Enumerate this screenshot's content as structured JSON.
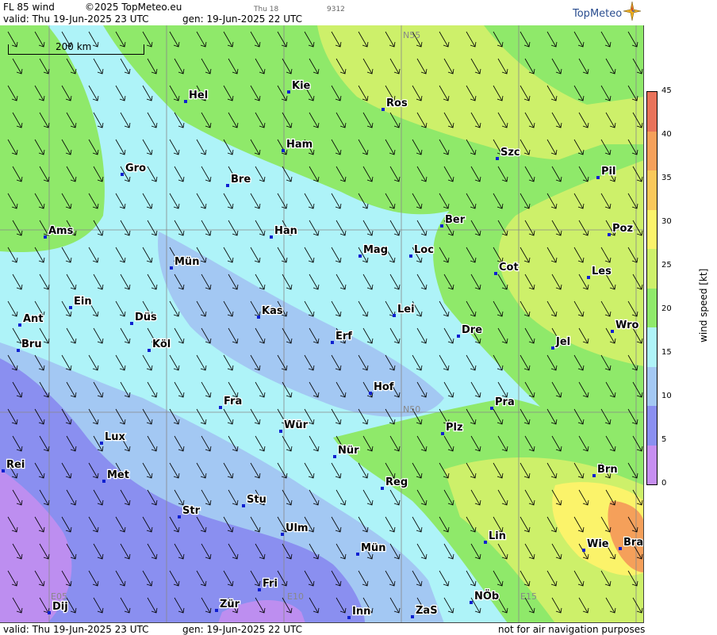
{
  "header": {
    "product": "FL 85 wind",
    "copyright": "©2025 TopMeteo.eu",
    "valid": "valid:  Thu  19-Jun-2025  23 UTC",
    "gen": "gen: 19-Jun-2025 22 UTC",
    "day": "Thu 18",
    "code": "9312",
    "logo": "TopMeteo"
  },
  "footer": {
    "valid": "valid:  Thu  19-Jun-2025  23 UTC",
    "gen": "gen: 19-Jun-2025 22 UTC",
    "disclaimer": "not for air navigation purposes"
  },
  "scale_bar": {
    "label": "200 km"
  },
  "grid_labels": [
    {
      "text": "N55"
    },
    {
      "text": "N50"
    },
    {
      "text": "E05"
    },
    {
      "text": "E10"
    },
    {
      "text": "E15"
    }
  ],
  "colorbar": {
    "title": "wind speed [kt]",
    "ticks": [
      "45",
      "40",
      "35",
      "30",
      "25",
      "20",
      "15",
      "10",
      "5",
      "0"
    ],
    "colors": [
      "#e8725a",
      "#f5a05a",
      "#f9c85a",
      "#fbf36a",
      "#cdf06a",
      "#8fe96a",
      "#aef3f8",
      "#a3c8f3",
      "#8a8ff0",
      "#c68ef0"
    ]
  },
  "cities": [
    {
      "name": "Hel"
    },
    {
      "name": "Kie"
    },
    {
      "name": "Ros"
    },
    {
      "name": "Ham"
    },
    {
      "name": "Szc"
    },
    {
      "name": "Gro"
    },
    {
      "name": "Bre"
    },
    {
      "name": "Pil"
    },
    {
      "name": "Ber"
    },
    {
      "name": "Ams"
    },
    {
      "name": "Han"
    },
    {
      "name": "Poz"
    },
    {
      "name": "Mag"
    },
    {
      "name": "Loc"
    },
    {
      "name": "Mün"
    },
    {
      "name": "Cot"
    },
    {
      "name": "Les"
    },
    {
      "name": "Ein"
    },
    {
      "name": "Kas"
    },
    {
      "name": "Lei"
    },
    {
      "name": "Ant"
    },
    {
      "name": "Düs"
    },
    {
      "name": "Dre"
    },
    {
      "name": "Wro"
    },
    {
      "name": "Erf"
    },
    {
      "name": "Bru"
    },
    {
      "name": "Köl"
    },
    {
      "name": "Jel"
    },
    {
      "name": "Hof"
    },
    {
      "name": "Fra"
    },
    {
      "name": "Pra"
    },
    {
      "name": "Wür"
    },
    {
      "name": "Lux"
    },
    {
      "name": "Plz"
    },
    {
      "name": "Nür"
    },
    {
      "name": "Rei"
    },
    {
      "name": "Met"
    },
    {
      "name": "Brn"
    },
    {
      "name": "Reg"
    },
    {
      "name": "Stu"
    },
    {
      "name": "Str"
    },
    {
      "name": "Ulm"
    },
    {
      "name": "Lin"
    },
    {
      "name": "Wie"
    },
    {
      "name": "Bra"
    },
    {
      "name": "Mün"
    },
    {
      "name": "Fri"
    },
    {
      "name": "NÖb"
    },
    {
      "name": "Dij"
    },
    {
      "name": "Zür"
    },
    {
      "name": "Inn"
    },
    {
      "name": "ZaS"
    }
  ]
}
